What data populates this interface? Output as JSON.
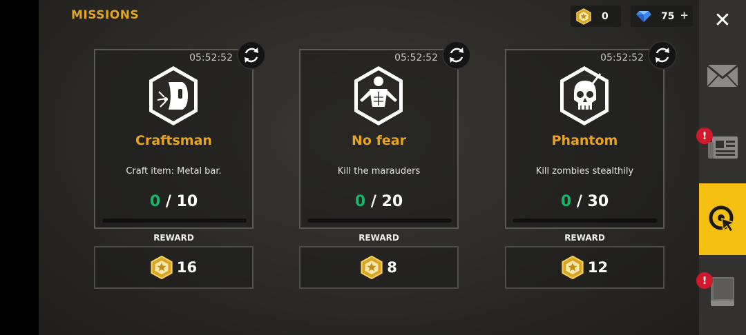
{
  "header": {
    "title": "MISSIONS"
  },
  "currency": {
    "badges": "0",
    "gems": "75",
    "gems_add": "+"
  },
  "cards": [
    {
      "timer": "05:52:52",
      "name": "Craftsman",
      "description": "Craft item: Metal bar.",
      "current": "0",
      "separator": "/",
      "target": "10",
      "reward_label": "REWARD",
      "reward": "16",
      "progress": 0,
      "icon": "welding-mask-icon"
    },
    {
      "timer": "05:52:52",
      "name": "No fear",
      "description": "Kill the marauders",
      "current": "0",
      "separator": "/",
      "target": "20",
      "reward_label": "REWARD",
      "reward": "8",
      "progress": 0,
      "icon": "fighter-icon"
    },
    {
      "timer": "05:52:52",
      "name": "Phantom",
      "description": "Kill zombies stealthily",
      "current": "0",
      "separator": "/",
      "target": "30",
      "reward_label": "REWARD",
      "reward": "12",
      "progress": 0,
      "icon": "skull-knife-icon"
    }
  ],
  "sidebar": {
    "close": "✕",
    "alert_mark": "!",
    "items": [
      "mail-icon",
      "news-icon",
      "missions-icon",
      "journal-icon"
    ],
    "active": "missions-icon"
  },
  "colors": {
    "accent": "#e6a41f",
    "progress": "#19b46a",
    "active_tab": "#f5c012",
    "alert": "#d0192a"
  }
}
